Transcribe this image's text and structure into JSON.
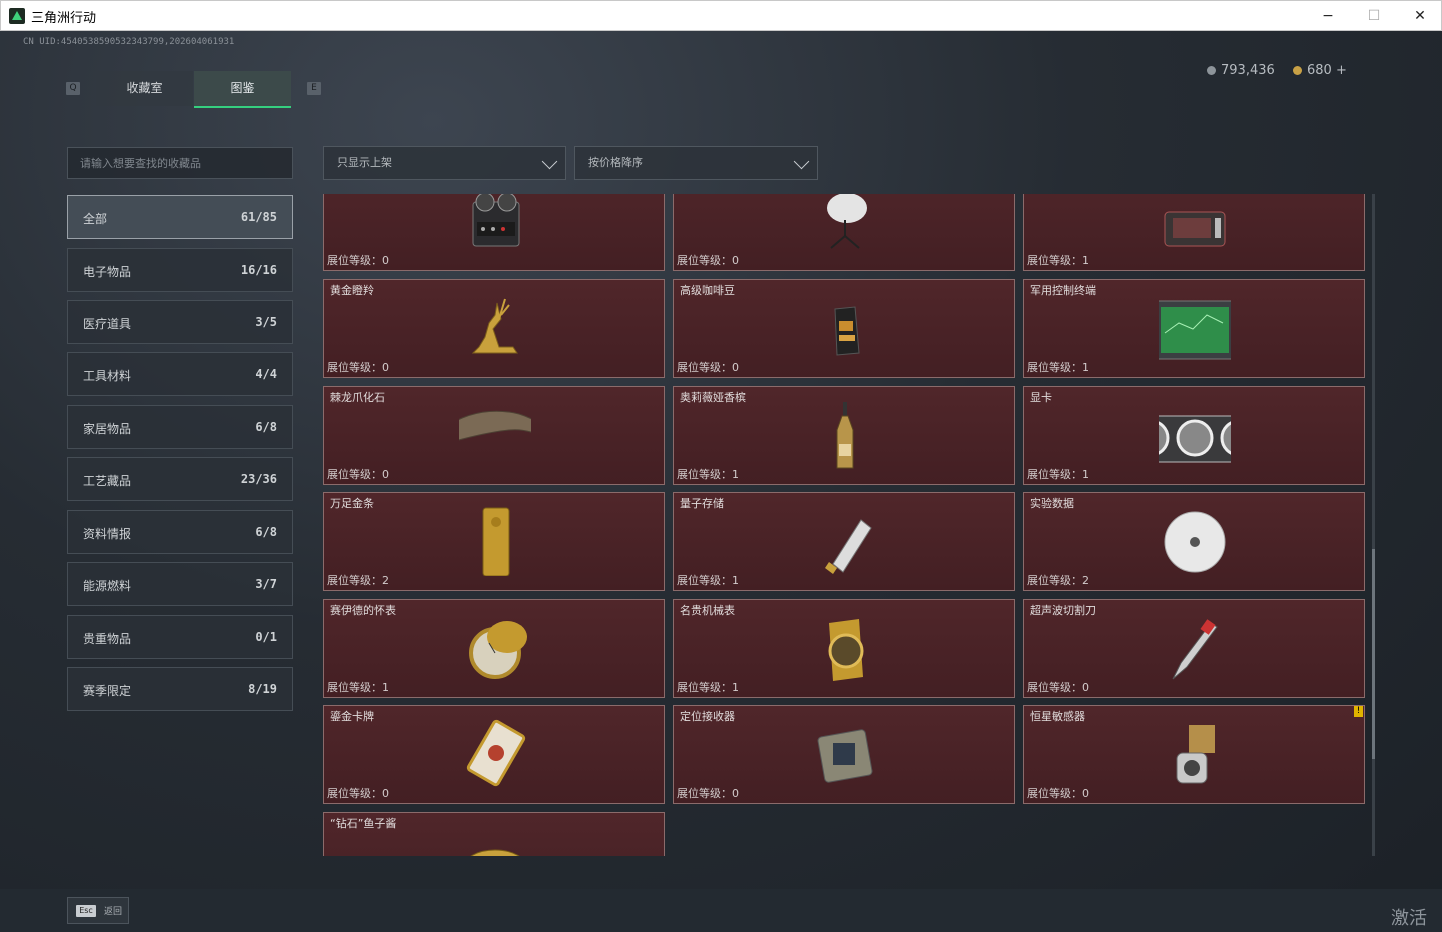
{
  "window": {
    "title": "三角洲行动",
    "minimize": "−",
    "maximize": "☐",
    "close": "✕"
  },
  "uid": "CN UID:4540538590532343799,202604061931",
  "currency": [
    {
      "icon": "silver-coin-icon",
      "value": "793,436"
    },
    {
      "icon": "gold-coin-icon",
      "value": "680 +"
    }
  ],
  "tabs": {
    "left_key": "Q",
    "right_key": "E",
    "items": [
      "收藏室",
      "图鉴"
    ],
    "active": 1
  },
  "search": {
    "placeholder": "请输入想要查找的收藏品",
    "value": ""
  },
  "filters": {
    "show": "只显示上架",
    "sort": "按价格降序"
  },
  "categories": [
    {
      "label": "全部",
      "count": "61/85",
      "active": true
    },
    {
      "label": "电子物品",
      "count": "16/16"
    },
    {
      "label": "医疗道具",
      "count": "3/5"
    },
    {
      "label": "工具材料",
      "count": "4/4"
    },
    {
      "label": "家居物品",
      "count": "6/8"
    },
    {
      "label": "工艺藏品",
      "count": "23/36"
    },
    {
      "label": "资料情报",
      "count": "6/8"
    },
    {
      "label": "能源燃料",
      "count": "3/7"
    },
    {
      "label": "贵重物品",
      "count": "0/1"
    },
    {
      "label": "赛季限定",
      "count": "8/19"
    }
  ],
  "items": [
    {
      "name": "",
      "level": "展位等级：0",
      "icon": "reel-tape-recorder-icon"
    },
    {
      "name": "",
      "level": "展位等级：0",
      "icon": "satellite-dish-icon"
    },
    {
      "name": "",
      "level": "展位等级：1",
      "icon": "radio-device-icon"
    },
    {
      "name": "黄金瞪羚",
      "level": "展位等级：0",
      "icon": "golden-gazelle-icon"
    },
    {
      "name": "高级咖啡豆",
      "level": "展位等级：0",
      "icon": "coffee-bag-icon"
    },
    {
      "name": "军用控制终端",
      "level": "展位等级：1",
      "icon": "control-terminal-icon"
    },
    {
      "name": "棘龙爪化石",
      "level": "展位等级：0",
      "icon": "claw-fossil-icon"
    },
    {
      "name": "奥莉薇娅香槟",
      "level": "展位等级：1",
      "icon": "champagne-bottle-icon"
    },
    {
      "name": "显卡",
      "level": "展位等级：1",
      "icon": "graphics-card-icon"
    },
    {
      "name": "万足金条",
      "level": "展位等级：2",
      "icon": "gold-bar-icon"
    },
    {
      "name": "量子存储",
      "level": "展位等级：1",
      "icon": "quantum-storage-icon"
    },
    {
      "name": "实验数据",
      "level": "展位等级：2",
      "icon": "data-disc-icon"
    },
    {
      "name": "赛伊德的怀表",
      "level": "展位等级：1",
      "icon": "pocket-watch-icon"
    },
    {
      "name": "名贵机械表",
      "level": "展位等级：1",
      "icon": "wristwatch-icon"
    },
    {
      "name": "超声波切割刀",
      "level": "展位等级：0",
      "icon": "ultrasonic-cutter-icon"
    },
    {
      "name": "鎏金卡牌",
      "level": "展位等级：0",
      "icon": "gilded-card-icon"
    },
    {
      "name": "定位接收器",
      "level": "展位等级：0",
      "icon": "locator-receiver-icon"
    },
    {
      "name": "恒星敏感器",
      "level": "展位等级：0",
      "icon": "star-sensor-icon"
    },
    {
      "name": "“钻石”鱼子酱",
      "level": "",
      "icon": "caviar-tin-icon"
    }
  ],
  "warning_badge": "!",
  "footer": {
    "esc_key": "Esc",
    "esc_label": "返回",
    "watermark": "激活"
  }
}
